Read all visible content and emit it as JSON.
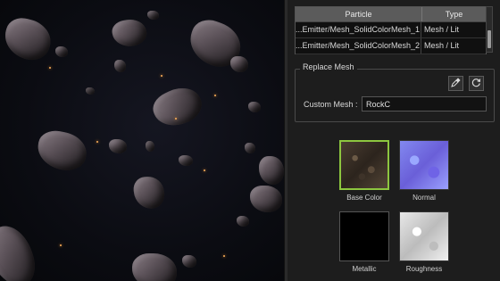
{
  "particle_table": {
    "columns": [
      "Particle",
      "Type"
    ],
    "rows": [
      {
        "particle": "...Emitter/Mesh_SolidColorMesh_1",
        "type": "Mesh / Lit"
      },
      {
        "particle": "...Emitter/Mesh_SolidColorMesh_2",
        "type": "Mesh / Lit"
      }
    ],
    "selected_row": 0
  },
  "replace_mesh": {
    "title": "Replace Mesh",
    "picker_icon": "eyedropper-icon",
    "refresh_icon": "refresh-icon",
    "custom_mesh_label": "Custom Mesh :",
    "custom_mesh_value": "RockC"
  },
  "textures": [
    {
      "label": "Base Color",
      "selected": true
    },
    {
      "label": "Normal",
      "selected": false
    },
    {
      "label": "Metallic",
      "selected": false
    },
    {
      "label": "Roughness",
      "selected": false
    }
  ],
  "colors": {
    "panel_bg": "#1d1d1d",
    "header_bg": "#5b5b5b",
    "selection_border": "#8dc63f"
  }
}
